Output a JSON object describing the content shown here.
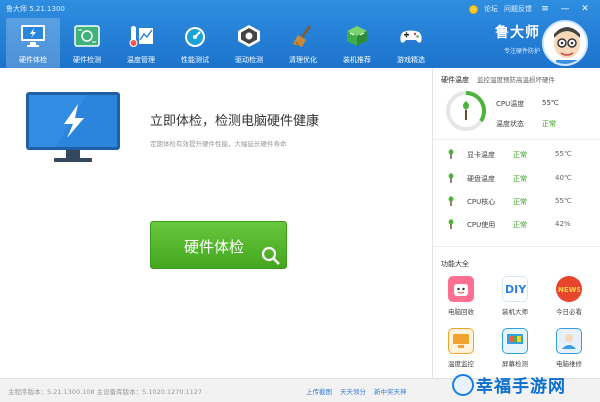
{
  "titlebar": {
    "app_title": "鲁大师 5.21.1300",
    "links": [
      "论坛",
      "问题反馈"
    ],
    "buttons": [
      "≡",
      "—",
      "✕"
    ]
  },
  "nav": [
    {
      "label": "硬件体检",
      "icon": "monitor-bolt-icon"
    },
    {
      "label": "硬件检测",
      "icon": "circuit-board-icon"
    },
    {
      "label": "温度管理",
      "icon": "thermometer-chart-icon"
    },
    {
      "label": "性能测试",
      "icon": "speedometer-icon"
    },
    {
      "label": "驱动检测",
      "icon": "gear-chip-icon"
    },
    {
      "label": "清理优化",
      "icon": "broom-icon"
    },
    {
      "label": "装机推荐",
      "icon": "cube-icon"
    },
    {
      "label": "游戏精选",
      "icon": "gamepad-icon"
    }
  ],
  "brand": {
    "name": "鲁大师",
    "sub": "专注硬件防护"
  },
  "main": {
    "headline": "立即体检，检测电脑硬件健康",
    "subline": "定期体检有效提升硬件性能，大幅延长硬件寿命",
    "check_button": "硬件体检"
  },
  "side": {
    "title": "硬件温度",
    "note": "监控温度预防高温损坏硬件",
    "cpu_temp_label": "CPU温度",
    "cpu_temp_value": "55℃",
    "temp_state_label": "温度状态",
    "temp_state_value": "正常",
    "rows": [
      {
        "name": "显卡温度",
        "status": "正常",
        "value": "55℃"
      },
      {
        "name": "硬盘温度",
        "status": "正常",
        "value": "40℃"
      },
      {
        "name": "CPU核心",
        "status": "正常",
        "value": "55℃"
      },
      {
        "name": "CPU使用",
        "status": "正常",
        "value": "42%"
      }
    ],
    "features_title": "功能大全",
    "features": [
      {
        "label": "电脑回收",
        "icon": "face-bag-icon",
        "color": "#ff6f91"
      },
      {
        "label": "装机大师",
        "icon": "diy-icon",
        "color": "#2f7fe0"
      },
      {
        "label": "今日必看",
        "icon": "news-icon",
        "color": "#e8452c"
      },
      {
        "label": "温度监控",
        "icon": "monitor-icon",
        "color": "#f2a32e"
      },
      {
        "label": "屏幕检测",
        "icon": "screen-icon",
        "color": "#2fa3e0"
      },
      {
        "label": "电脑维修",
        "icon": "person-icon",
        "color": "#3a9be0"
      }
    ]
  },
  "status": {
    "version": "主程序版本：5.21.1300.108    主设备库版本：5.1020.1270.1127",
    "links": [
      "上传截图",
      "天天领分",
      "新中奖天神"
    ]
  },
  "watermark": "幸福手游网",
  "colors": {
    "accent": "#1d73cc",
    "green": "#44a71f",
    "ok": "#35a01f"
  }
}
